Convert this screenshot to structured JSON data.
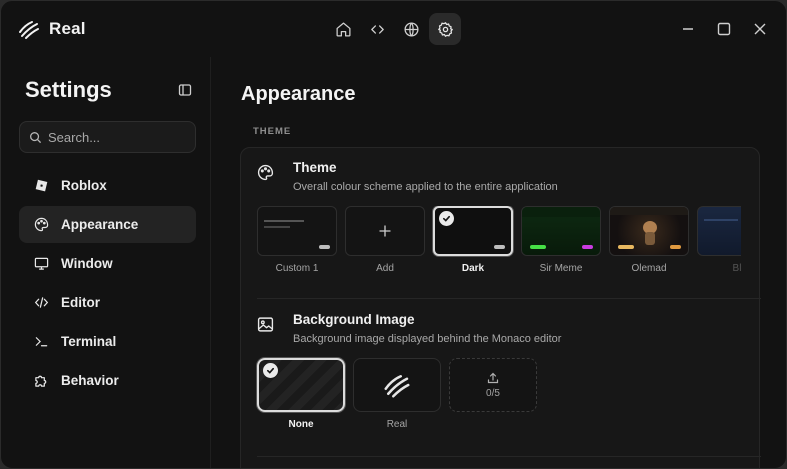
{
  "app": {
    "name": "Real"
  },
  "topnav": {
    "items": [
      {
        "icon": "home-icon"
      },
      {
        "icon": "code-icon"
      },
      {
        "icon": "globe-icon"
      },
      {
        "icon": "settings-icon",
        "active": true
      }
    ]
  },
  "window_controls": [
    "minimize-icon",
    "maximize-icon",
    "close-icon"
  ],
  "sidebar": {
    "title": "Settings",
    "search_placeholder": "Search...",
    "items": [
      {
        "label": "Roblox",
        "icon": "roblox-icon"
      },
      {
        "label": "Appearance",
        "icon": "palette-icon",
        "active": true
      },
      {
        "label": "Window",
        "icon": "monitor-icon"
      },
      {
        "label": "Editor",
        "icon": "code-icon"
      },
      {
        "label": "Terminal",
        "icon": "terminal-icon"
      },
      {
        "label": "Behavior",
        "icon": "puzzle-icon"
      }
    ]
  },
  "main": {
    "page_title": "Appearance",
    "section_label": "THEME",
    "theme": {
      "title": "Theme",
      "description": "Overall colour scheme applied to the entire application",
      "options": [
        {
          "name": "Custom 1"
        },
        {
          "name": "Add"
        },
        {
          "name": "Dark",
          "selected": true
        },
        {
          "name": "Sir Meme",
          "accents": [
            "#46e046",
            "#c83ce0"
          ]
        },
        {
          "name": "Olemad",
          "accents": [
            "#e8b860",
            "#e09a40"
          ]
        },
        {
          "name": "Bl"
        }
      ]
    },
    "background": {
      "title": "Background Image",
      "description": "Background image displayed behind the Monaco editor",
      "options": [
        {
          "name": "None",
          "selected": true
        },
        {
          "name": "Real"
        }
      ],
      "upload_count": "0/5"
    }
  },
  "colors": {
    "window_bg": "#121212",
    "card_bg": "#171717",
    "active_bg": "#232323",
    "text": "#ececec"
  }
}
